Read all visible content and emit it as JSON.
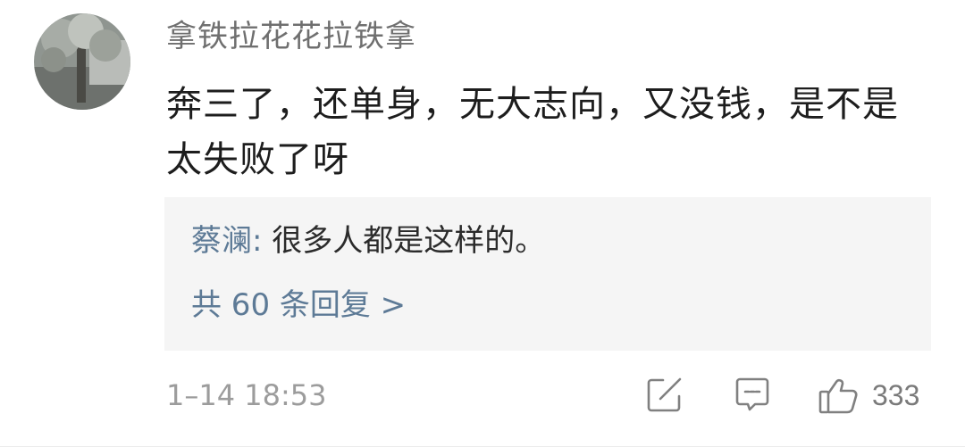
{
  "comment": {
    "username": "拿铁拉花花拉铁拿",
    "text": "奔三了，还单身，无大志向，又没钱，是不是太失败了呀",
    "timestamp": "1–14 18:53",
    "likes": "333"
  },
  "reply": {
    "author": "蔡澜",
    "separator": ":",
    "text": " 很多人都是这样的。",
    "more_label": "共 60 条回复 >"
  },
  "icons": {
    "edit": "edit-icon",
    "comment": "comment-icon",
    "like": "thumbs-up-icon"
  },
  "colors": {
    "link": "#5d7a96",
    "reply_bg": "#f5f5f5",
    "meta": "#9c9c9c"
  }
}
